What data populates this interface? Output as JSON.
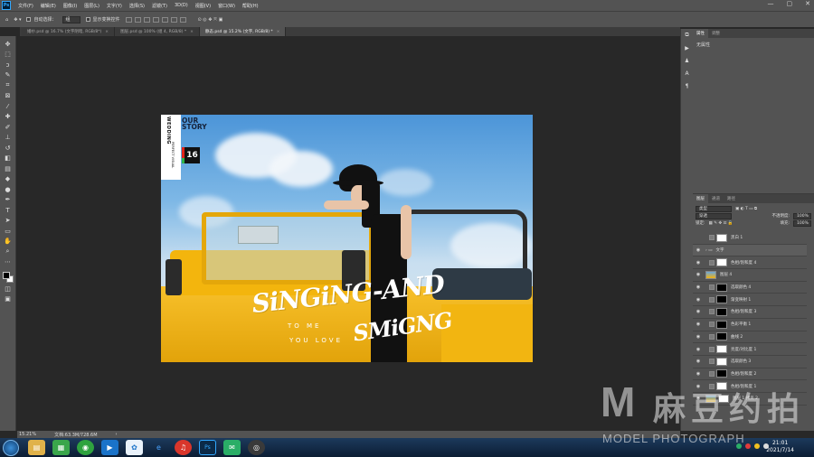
{
  "menubar": {
    "app_icon": "Ps",
    "items": [
      "文件(F)",
      "编辑(E)",
      "图像(I)",
      "图层(L)",
      "文字(Y)",
      "选择(S)",
      "滤镜(T)",
      "3D(D)",
      "视图(V)",
      "窗口(W)",
      "帮助(H)"
    ],
    "window_controls": [
      "—",
      "▢",
      "✕"
    ]
  },
  "options": {
    "auto_select_label": "自动选择：",
    "auto_select_value": "组",
    "transform_label": "显示变换控件"
  },
  "tabs": [
    {
      "label": "婚纱.psd @ 16.7% (文字阴暗, RGB/8*)",
      "active": false
    },
    {
      "label": "图层.psd @ 100% (组 4, RGB/8) *",
      "active": false
    },
    {
      "label": "静态.psd @ 15.2% (文字, RGB/8) *",
      "active": true
    }
  ],
  "tools": [
    "move-tool",
    "marquee-tool",
    "lasso-tool",
    "quick-select-tool",
    "crop-tool",
    "frame-tool",
    "eyedropper-tool",
    "healing-tool",
    "brush-tool",
    "stamp-tool",
    "history-brush-tool",
    "eraser-tool",
    "gradient-tool",
    "blur-tool",
    "dodge-tool",
    "pen-tool",
    "type-tool",
    "path-select-tool",
    "shape-tool",
    "hand-tool",
    "zoom-tool"
  ],
  "photo": {
    "cover_vertical": "WEDDING",
    "cover_story_line1": "OUR",
    "cover_story_line2": "STORY",
    "cover_perfect": "PERFECT VISUAL",
    "cover_number": "16",
    "headline": "SiNGiNG-AND",
    "headline2": "SMiGNG",
    "sub1": "TO ME",
    "sub2": "YOU LOVE"
  },
  "status": {
    "zoom": "15.21%",
    "doc": "文档:63.3M/728.6M"
  },
  "properties": {
    "tabs": [
      "属性",
      "调整"
    ],
    "body": "无属性"
  },
  "layers_panel": {
    "tabs": [
      "图层",
      "通道",
      "路径"
    ],
    "filter": "类型",
    "blend": "穿透",
    "opacity_label": "不透明度:",
    "opacity_value": "100%",
    "lock_label": "锁定:",
    "fill_label": "填充:",
    "fill_value": "100%",
    "layers": [
      {
        "name": "黑白 1",
        "eye": false,
        "thumb": "adj",
        "mask": "white",
        "selected": false
      },
      {
        "name": "文字",
        "eye": true,
        "thumb": "folder",
        "mask": "none",
        "selected": true
      },
      {
        "name": "色相/饱和度 4",
        "eye": true,
        "thumb": "adj",
        "mask": "white",
        "selected": false
      },
      {
        "name": "图层 4",
        "eye": true,
        "thumb": "photo",
        "mask": "none",
        "selected": false
      },
      {
        "name": "选取颜色 4",
        "eye": true,
        "thumb": "adj",
        "mask": "black",
        "selected": false
      },
      {
        "name": "渐变映射 1",
        "eye": true,
        "thumb": "adj",
        "mask": "black",
        "selected": false
      },
      {
        "name": "色相/饱和度 3",
        "eye": true,
        "thumb": "adj",
        "mask": "black",
        "selected": false
      },
      {
        "name": "色彩平衡 1",
        "eye": true,
        "thumb": "adj",
        "mask": "black",
        "selected": false
      },
      {
        "name": "曲线 2",
        "eye": true,
        "thumb": "adj",
        "mask": "black",
        "selected": false
      },
      {
        "name": "亮度/对比度 1",
        "eye": true,
        "thumb": "adj",
        "mask": "white",
        "selected": false
      },
      {
        "name": "选取颜色 3",
        "eye": true,
        "thumb": "adj",
        "mask": "white",
        "selected": false
      },
      {
        "name": "色相/饱和度 2",
        "eye": true,
        "thumb": "adj",
        "mask": "black",
        "selected": false
      },
      {
        "name": "色相/饱和度 1",
        "eye": true,
        "thumb": "adj",
        "mask": "white",
        "selected": false
      },
      {
        "name": "图层 1 拷贝 2",
        "eye": true,
        "thumb": "photo",
        "mask": "white",
        "selected": false
      }
    ]
  },
  "taskbar": {
    "time": "21:01",
    "date": "2021/7/14"
  },
  "watermark": {
    "letter": "M",
    "chinese": "麻豆约拍",
    "english": "MODEL PHOTOGRAPH"
  },
  "colors": {
    "accent": "#31a8ff",
    "panel": "#535353",
    "canvas_bg": "#282828",
    "car_yellow": "#f5b80e"
  }
}
